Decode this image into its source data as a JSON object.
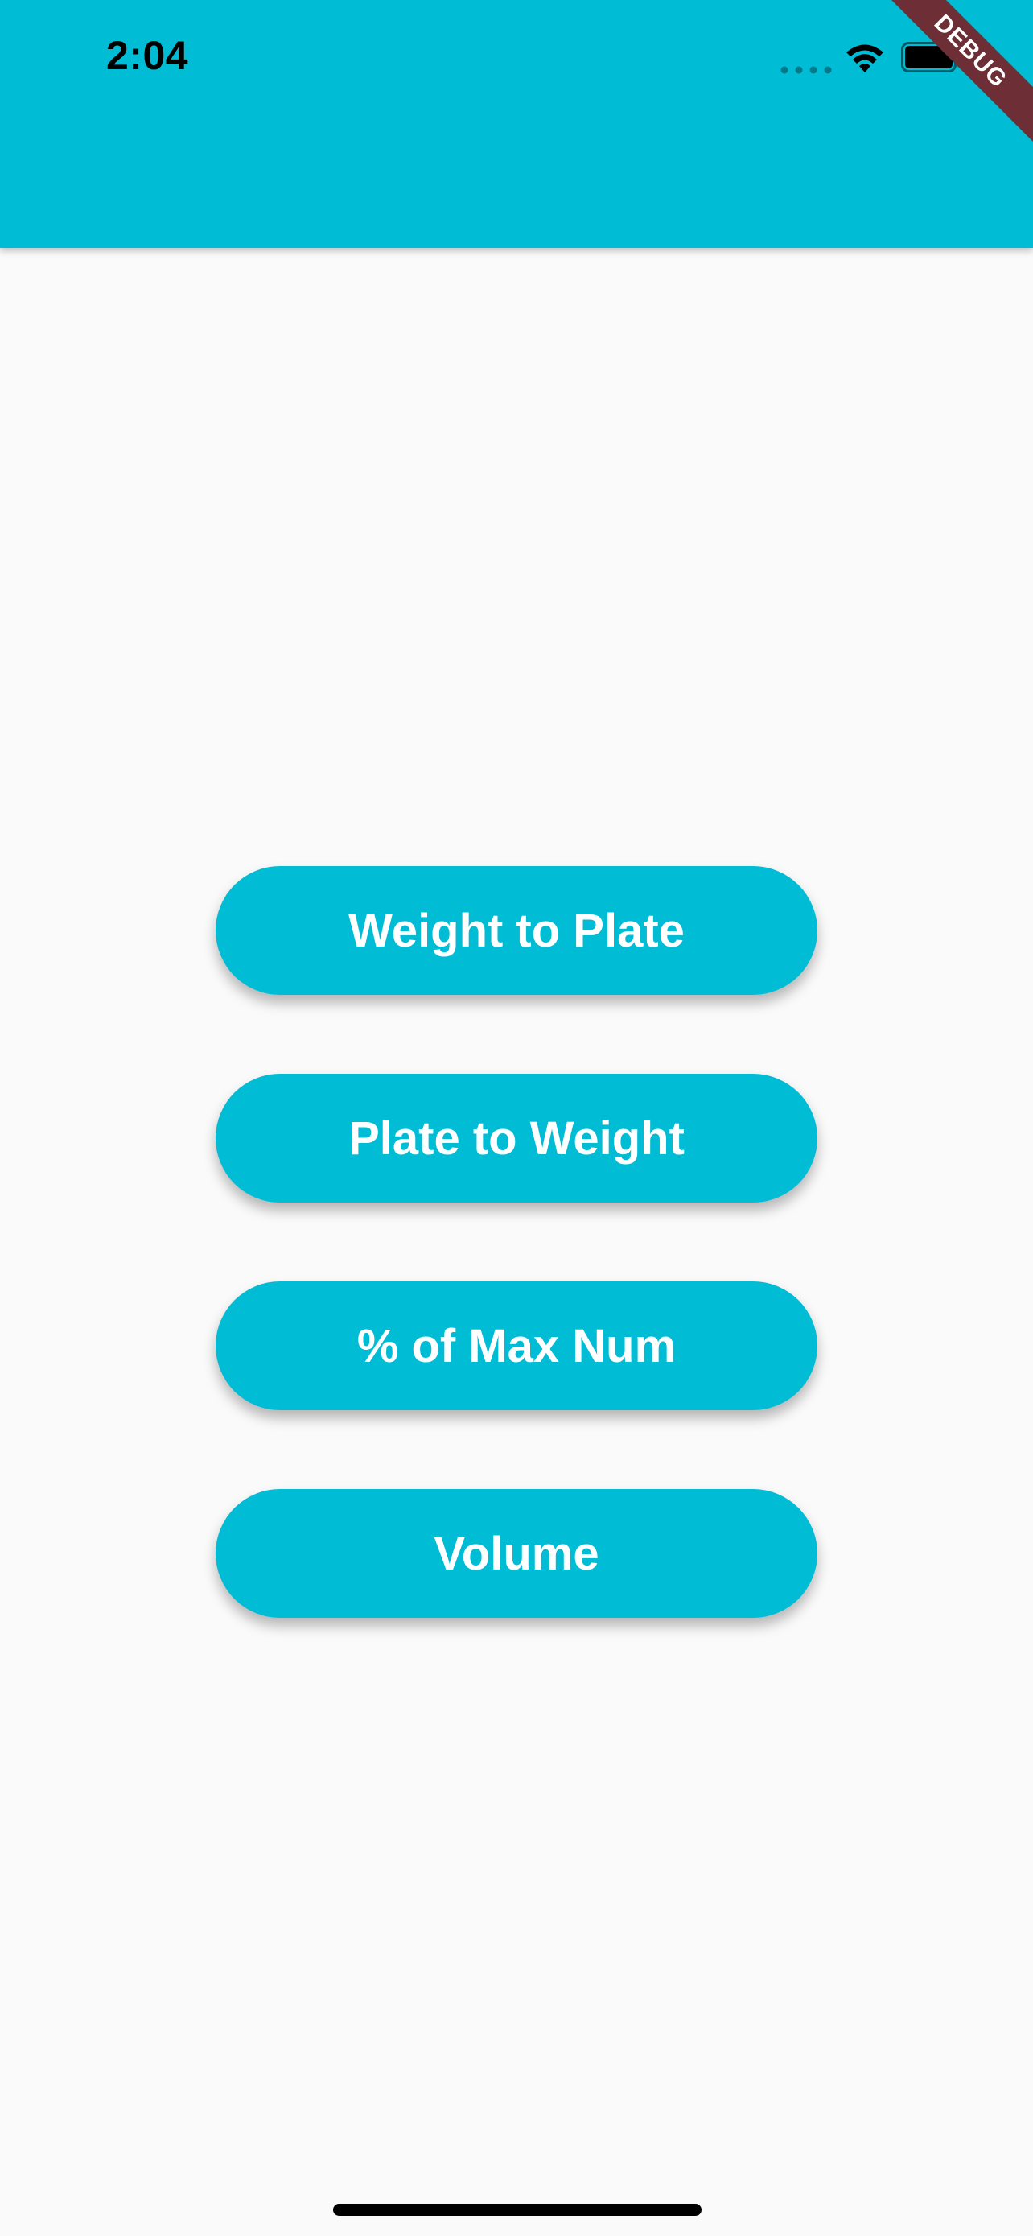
{
  "status_bar": {
    "time": "2:04",
    "icons": [
      "signal-dots-icon",
      "wifi-icon",
      "battery-icon"
    ]
  },
  "debug_banner": {
    "label": "DEBUG"
  },
  "menu": {
    "buttons": [
      {
        "label": "Weight to Plate"
      },
      {
        "label": "Plate to Weight"
      },
      {
        "label": "% of Max Num"
      },
      {
        "label": "Volume"
      }
    ]
  },
  "colors": {
    "accent": "#00bcd4",
    "background": "#fafafa",
    "debug_banner": "#6e2e35"
  }
}
